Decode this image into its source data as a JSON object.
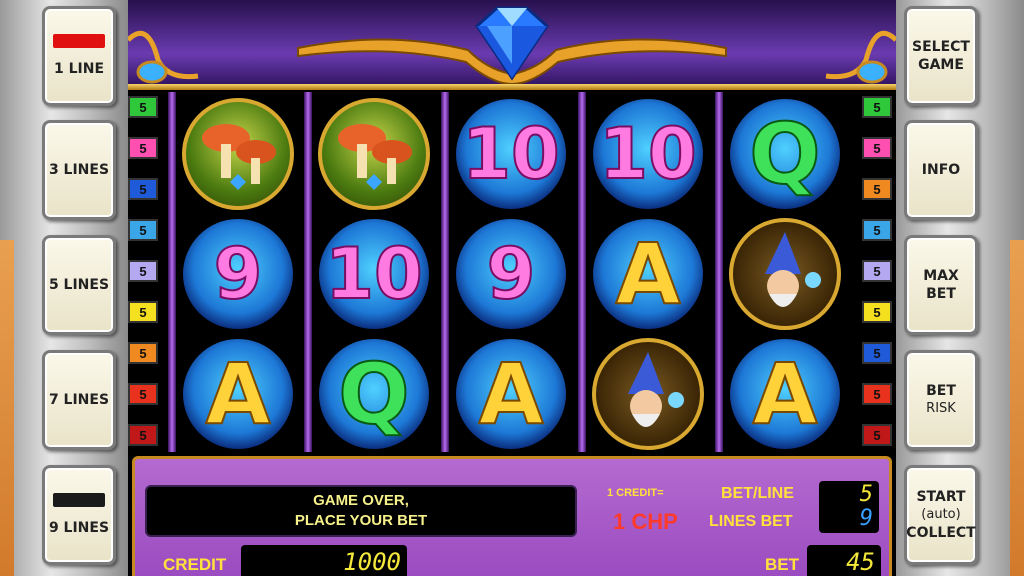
{
  "left_buttons": [
    {
      "label": "1 LINE",
      "bar_color": "#e01010"
    },
    {
      "label": "3 LINES"
    },
    {
      "label": "5 LINES"
    },
    {
      "label": "7 LINES"
    },
    {
      "label": "9 LINES",
      "bar_color": "#1a1a1a"
    }
  ],
  "right_buttons": [
    {
      "line1": "SELECT",
      "line2": "GAME"
    },
    {
      "line1": "INFO",
      "line2": ""
    },
    {
      "line1": "MAX",
      "line2": "BET"
    },
    {
      "line1": "BET",
      "line2": "RISK"
    },
    {
      "line1": "START",
      "line2": "(auto)",
      "line3": "COLLECT"
    }
  ],
  "line_indicators": {
    "left": [
      {
        "value": "5",
        "color": "#2ec83a"
      },
      {
        "value": "5",
        "color": "#ff4fb0"
      },
      {
        "value": "5",
        "color": "#1f5ad8"
      },
      {
        "value": "5",
        "color": "#3aa6e8"
      },
      {
        "value": "5",
        "color": "#b4a8f0"
      },
      {
        "value": "5",
        "color": "#f5e020"
      },
      {
        "value": "5",
        "color": "#f08a20"
      },
      {
        "value": "5",
        "color": "#e8321e"
      },
      {
        "value": "5",
        "color": "#c01818"
      }
    ],
    "right": [
      {
        "value": "5",
        "color": "#2ec83a"
      },
      {
        "value": "5",
        "color": "#ff4fb0"
      },
      {
        "value": "5",
        "color": "#f08a20"
      },
      {
        "value": "5",
        "color": "#3aa6e8"
      },
      {
        "value": "5",
        "color": "#b4a8f0"
      },
      {
        "value": "5",
        "color": "#f5e020"
      },
      {
        "value": "5",
        "color": "#1f5ad8"
      },
      {
        "value": "5",
        "color": "#e8321e"
      },
      {
        "value": "5",
        "color": "#c01818"
      }
    ]
  },
  "reels": [
    [
      "mushroom-symbol",
      "9",
      "A"
    ],
    [
      "mushroom-symbol",
      "10",
      "Q"
    ],
    [
      "10",
      "9",
      "A"
    ],
    [
      "10",
      "A",
      "gnome-symbol"
    ],
    [
      "Q",
      "gnome-symbol",
      "A"
    ]
  ],
  "console": {
    "message_line1": "GAME OVER,",
    "message_line2": "PLACE YOUR BET",
    "credit_rate_label": "1 CREDIT=",
    "credit_rate_value": "1 CHP",
    "bet_per_line_label": "BET/LINE",
    "lines_bet_label": "LINES BET",
    "bet_per_line_value": "5",
    "lines_bet_value": "9",
    "credit_label": "CREDIT",
    "credit_value": "1000",
    "bet_label": "BET",
    "bet_value": "45"
  },
  "colors": {
    "lcd_yellow": "#f5e83a",
    "lcd_blue": "#3aa0ff",
    "accent_gold": "#ffe23a"
  }
}
